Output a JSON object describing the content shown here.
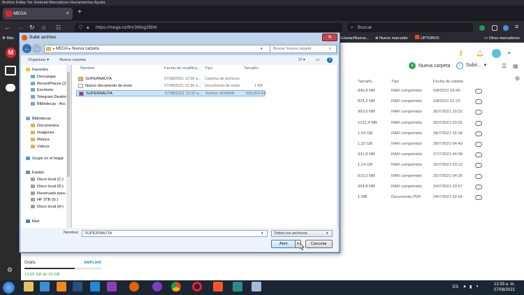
{
  "browser": {
    "menu_items": "Archivo  Editar  Ver  Historial  Marcadores  Herramientas  Ayuda",
    "tab_title": "MEGA",
    "url": "https://mega.nz/fm/3Wog2BhK",
    "search_placeholder": "Buscar",
    "bookmarks": {
      "left": "Más",
      "tag_text": "G/asian/Nueva...",
      "new_bookmark": "Nuevo marcador",
      "uptobox": "UPTOBOX",
      "other": "Otros marcadores"
    }
  },
  "mega": {
    "logo_letter": "M",
    "new_folder": "Nueva carpeta",
    "upload": "Subir...",
    "columns": {
      "size": "Tamaño",
      "type": "Tipo",
      "date": "Fecha de subida"
    },
    "rows": [
      {
        "size": "846,8 MB",
        "type": "RAR comprimido",
        "date": "5/8/2021 03:45"
      },
      {
        "size": "824,2 MB",
        "type": "RAR comprimido",
        "date": "2/8/2021 01:15"
      },
      {
        "size": "993,6 MB",
        "type": "RAR comprimido",
        "date": "30/7/2021 15:52"
      },
      {
        "size": "1012,4 MB",
        "type": "RAR comprimido",
        "date": "30/7/2021 03:55"
      },
      {
        "size": "1,04 GB",
        "type": "RAR comprimido",
        "date": "28/7/2021 16:34"
      },
      {
        "size": "1,22 GB",
        "type": "RAR comprimido",
        "date": "28/7/2021 04:40"
      },
      {
        "size": "931,8 MB",
        "type": "RAR comprimido",
        "date": "27/7/2021 04:09"
      },
      {
        "size": "1,14 GB",
        "type": "RAR comprimido",
        "date": "26/7/2021 03:12"
      },
      {
        "size": "819,2 MB",
        "type": "RAR comprimido",
        "date": "25/7/2021 04:26"
      },
      {
        "size": "954,8 MB",
        "type": "RAR comprimido",
        "date": "24/7/2021 03:57"
      },
      {
        "size": "1 MB",
        "type": "Documento PDF",
        "date": "24/7/2021 02:54"
      }
    ],
    "storage": {
      "plan": "Gratis",
      "upgrade": "AMPLIAR",
      "used": "13,05 GB de 20 GB",
      "used_fraction": 0.65
    }
  },
  "dialog": {
    "title": "Subir archivo",
    "address": [
      "MEGA",
      "Nueva carpeta"
    ],
    "search_placeholder": "Buscar Nueva carpeta",
    "toolbar": {
      "organize": "Organizar ▾",
      "new_folder": "Nueva carpeta"
    },
    "favorites": {
      "header": "Favoritos",
      "items": [
        "Descargas",
        "RecentPlaces (2)",
        "Escritorio",
        "Telegram Deskto",
        "Bibliotecas - Acc"
      ]
    },
    "libraries": {
      "header": "Bibliotecas",
      "items": [
        "Documentos",
        "Imágenes",
        "Música",
        "Vídeos"
      ]
    },
    "homegroup": "Grupo en el hogar",
    "computer": {
      "header": "Equipo",
      "items": [
        "Disco local (C:)",
        "Disco local (D:)",
        "Reservado para e",
        "HF 3TB (G:)",
        "Disco local (H:)"
      ]
    },
    "network": "Red",
    "columns": {
      "name": "Nombre",
      "date": "Fecha de modifica...",
      "type": "Tipo",
      "size": "Tamaño"
    },
    "files": [
      {
        "name": "SUPERNAUTA",
        "date": "07/08/2021 12:30 a...",
        "type": "Carpeta de archivos",
        "size": ""
      },
      {
        "name": "Nuevo documento de texto",
        "date": "07/08/2021 12:30 a...",
        "type": "Documento de texto",
        "size": "1 KB"
      },
      {
        "name": "SUPERNAUTA",
        "date": "07/08/2021 12:32 a...",
        "type": "Archivo WinRAR",
        "size": "508.824 KB"
      }
    ],
    "filename_label": "Nombre:",
    "filename_value": "SUPERNAUTA",
    "filter": "Todos los archivos",
    "open": "Abrir",
    "cancel": "Cancelar"
  },
  "taskbar": {
    "lang": "ES",
    "time": "12:33 a. m.",
    "date": "07/08/2021"
  }
}
